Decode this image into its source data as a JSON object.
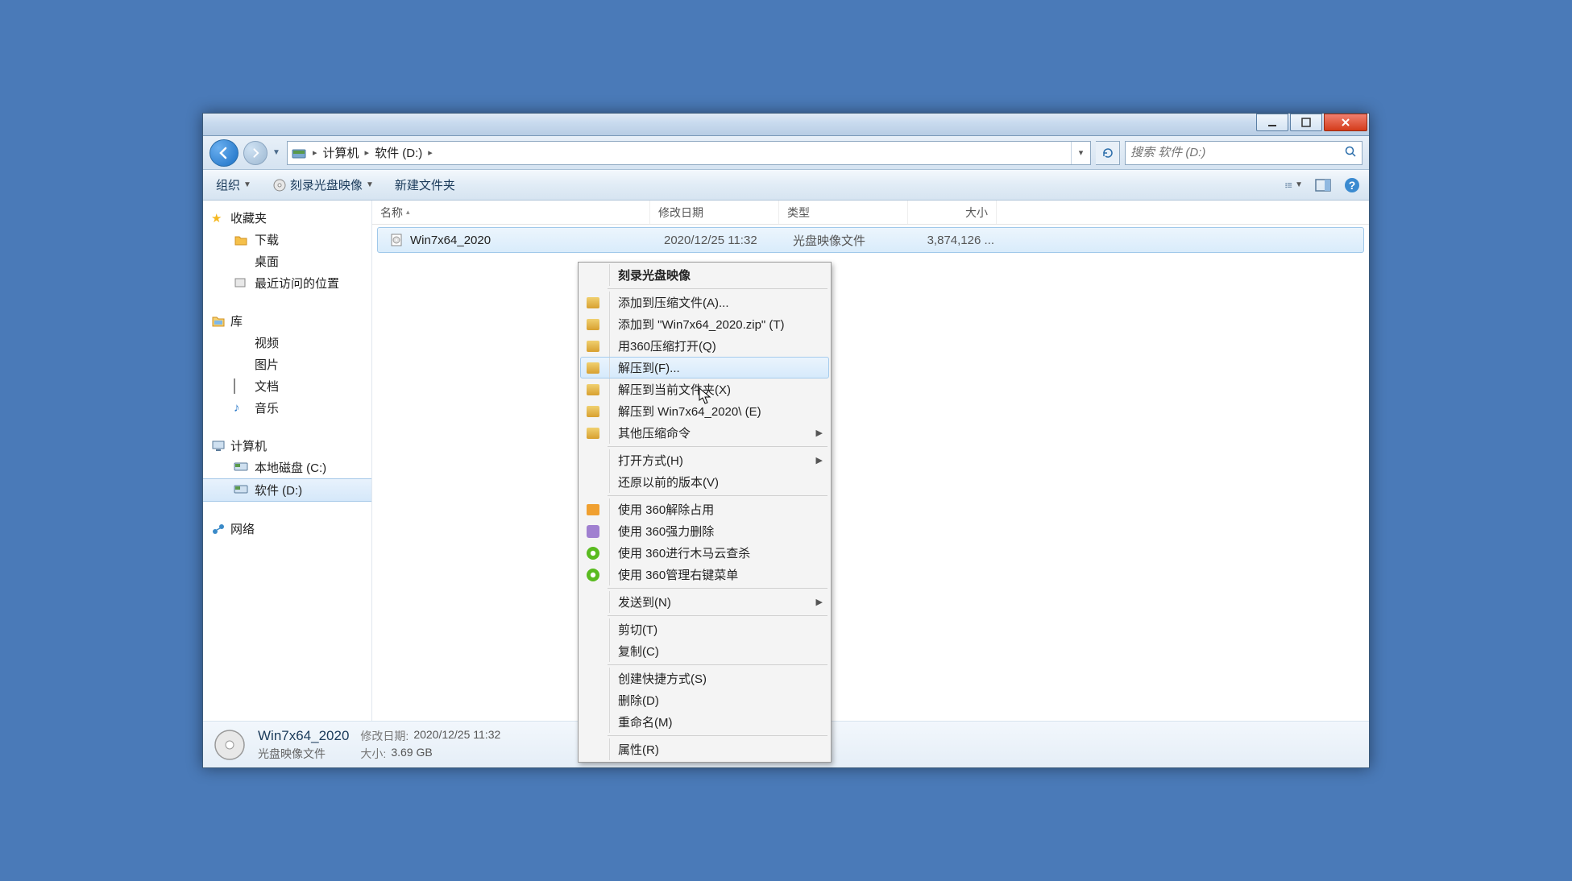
{
  "window": {
    "titlebar": {}
  },
  "navbar": {
    "breadcrumbs": [
      {
        "label": "计算机"
      },
      {
        "label": "软件 (D:)"
      }
    ],
    "search_placeholder": "搜索 软件 (D:)"
  },
  "toolbar": {
    "organize": "组织",
    "burn": "刻录光盘映像",
    "new_folder": "新建文件夹"
  },
  "sidebar": {
    "favorites": {
      "title": "收藏夹",
      "items": [
        {
          "label": "下载"
        },
        {
          "label": "桌面"
        },
        {
          "label": "最近访问的位置"
        }
      ]
    },
    "libraries": {
      "title": "库",
      "items": [
        {
          "label": "视频"
        },
        {
          "label": "图片"
        },
        {
          "label": "文档"
        },
        {
          "label": "音乐"
        }
      ]
    },
    "computer": {
      "title": "计算机",
      "items": [
        {
          "label": "本地磁盘 (C:)"
        },
        {
          "label": "软件 (D:)",
          "selected": true
        }
      ]
    },
    "network": {
      "title": "网络"
    }
  },
  "listview": {
    "columns": {
      "name": "名称",
      "date": "修改日期",
      "type": "类型",
      "size": "大小"
    },
    "rows": [
      {
        "name": "Win7x64_2020",
        "date": "2020/12/25 11:32",
        "type": "光盘映像文件",
        "size": "3,874,126 ...",
        "selected": true
      }
    ]
  },
  "context_menu": {
    "items": [
      {
        "label": "刻录光盘映像",
        "bold": true
      },
      {
        "sep": true
      },
      {
        "label": "添加到压缩文件(A)...",
        "icon": "zip"
      },
      {
        "label": "添加到 \"Win7x64_2020.zip\" (T)",
        "icon": "zip"
      },
      {
        "label": "用360压缩打开(Q)",
        "icon": "zip"
      },
      {
        "label": "解压到(F)...",
        "icon": "zip",
        "hovered": true
      },
      {
        "label": "解压到当前文件夹(X)",
        "icon": "zip"
      },
      {
        "label": "解压到 Win7x64_2020\\ (E)",
        "icon": "zip"
      },
      {
        "label": "其他压缩命令",
        "icon": "zip",
        "submenu": true
      },
      {
        "sep": true
      },
      {
        "label": "打开方式(H)",
        "submenu": true
      },
      {
        "label": "还原以前的版本(V)"
      },
      {
        "sep": true
      },
      {
        "label": "使用 360解除占用",
        "icon": "orange"
      },
      {
        "label": "使用 360强力删除",
        "icon": "purple"
      },
      {
        "label": "使用 360进行木马云查杀",
        "icon": "g360"
      },
      {
        "label": "使用 360管理右键菜单",
        "icon": "g360"
      },
      {
        "sep": true
      },
      {
        "label": "发送到(N)",
        "submenu": true
      },
      {
        "sep": true
      },
      {
        "label": "剪切(T)"
      },
      {
        "label": "复制(C)"
      },
      {
        "sep": true
      },
      {
        "label": "创建快捷方式(S)"
      },
      {
        "label": "删除(D)"
      },
      {
        "label": "重命名(M)"
      },
      {
        "sep": true
      },
      {
        "label": "属性(R)"
      }
    ]
  },
  "details": {
    "title": "Win7x64_2020",
    "subtitle": "光盘映像文件",
    "date_label": "修改日期:",
    "date_value": "2020/12/25 11:32",
    "size_label": "大小:",
    "size_value": "3.69 GB"
  }
}
